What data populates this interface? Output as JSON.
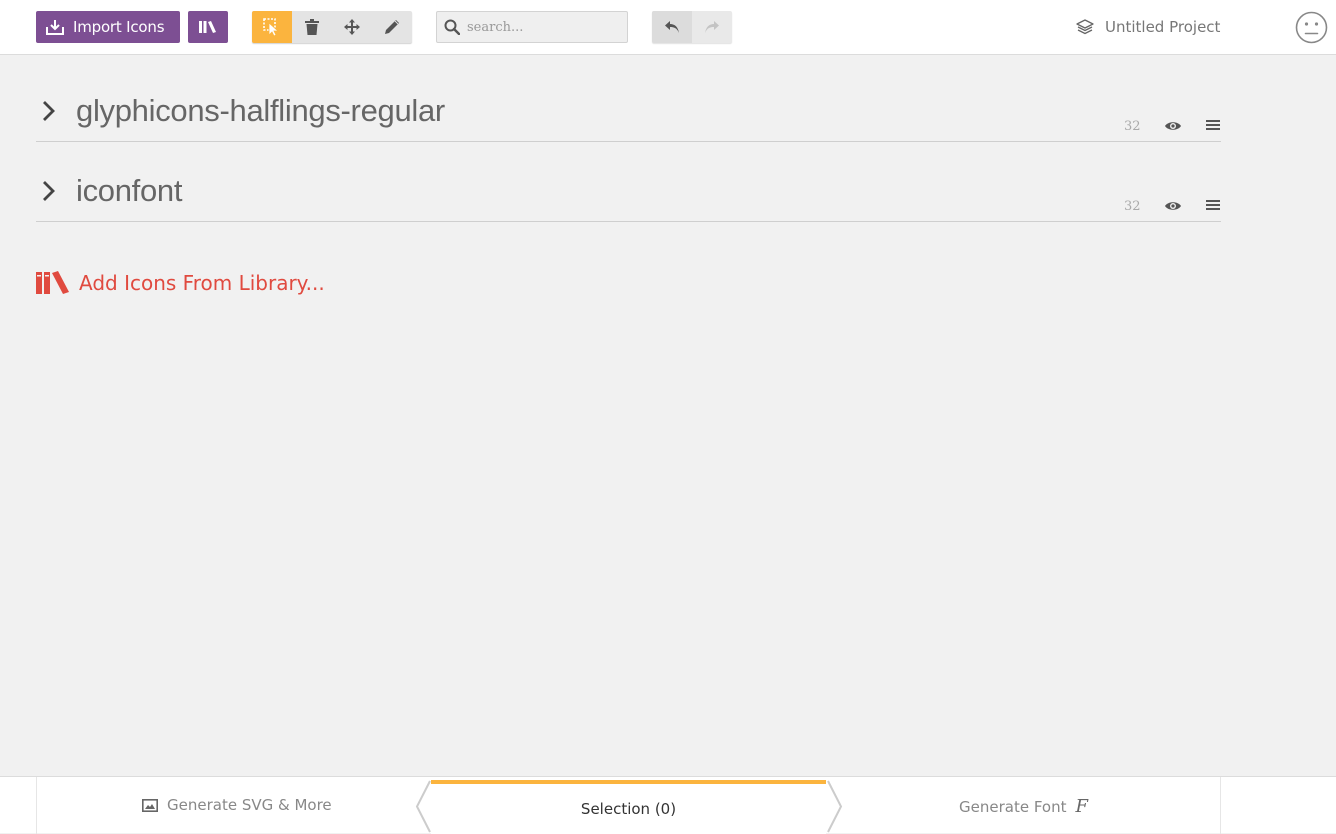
{
  "toolbar": {
    "import_label": "Import Icons",
    "search_placeholder": "search...",
    "project_name": "Untitled Project"
  },
  "sets": [
    {
      "name": "glyphicons-halflings-regular",
      "grid": "32"
    },
    {
      "name": "iconfont",
      "grid": "32"
    }
  ],
  "add_library_label": "Add Icons From Library...",
  "footer": {
    "generate_svg_label": "Generate SVG & More",
    "selection_label": "Selection (0)",
    "generate_font_label": "Generate Font",
    "font_glyph": "F"
  },
  "colors": {
    "primary": "#7d4f93",
    "accent": "#fbb43e",
    "library_red": "#e04a3f",
    "background": "#f1f1f1"
  }
}
